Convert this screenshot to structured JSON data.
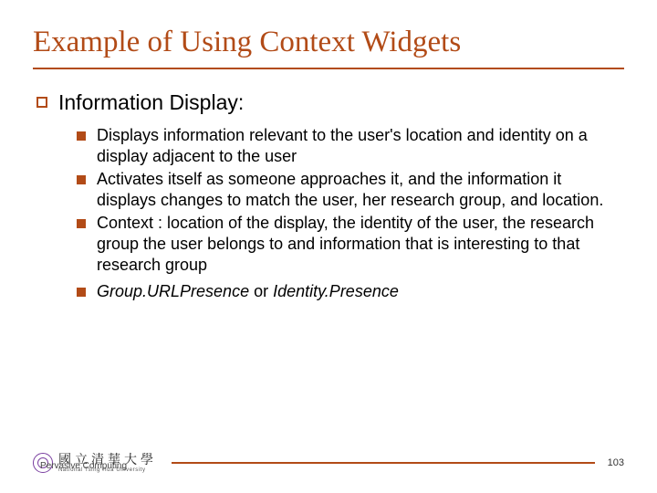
{
  "title": "Example of Using Context Widgets",
  "l1": {
    "text": "Information Display:"
  },
  "l2": [
    {
      "text": "Displays information relevant to the user's location and identity on a display adjacent to the user"
    },
    {
      "text": "Activates itself as someone approaches it, and the information it displays changes to match the user, her research group, and location."
    },
    {
      "text": "Context : location of the display, the identity of the user, the research group the user belongs to and information that is interesting to that research group"
    }
  ],
  "l2_last": {
    "italic1": "Group.URLPresence",
    "mid": " or ",
    "italic2": "Identity.Presence"
  },
  "footer": {
    "label": "Pervasive Computing",
    "uni_cn": "國立清華大學",
    "uni_en": "National  Tsing  Hua  University",
    "page": "103"
  }
}
